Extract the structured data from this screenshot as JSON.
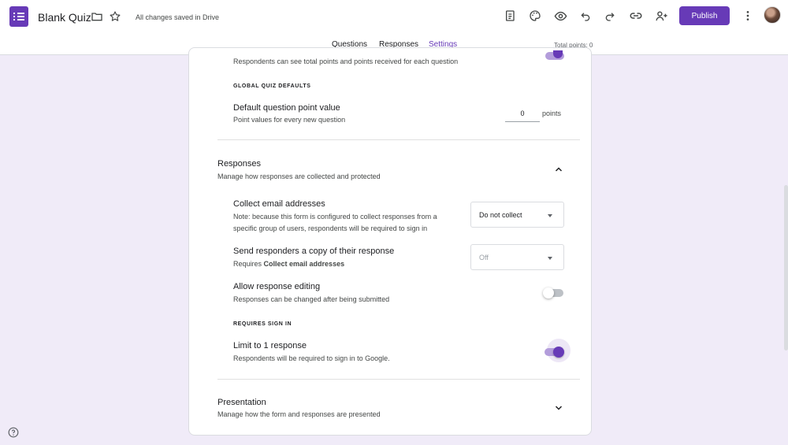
{
  "header": {
    "doc_title": "Blank Quiz",
    "save_status": "All changes saved in Drive",
    "publish_label": "Publish",
    "icons": [
      "forms-app-icon",
      "folder-icon",
      "star-icon",
      "customize-theme-icon",
      "palette-icon",
      "preview-eye-icon",
      "undo-icon",
      "redo-icon",
      "link-icon",
      "add-collaborator-icon",
      "more-vert-icon"
    ],
    "accent_color": "#673ab7"
  },
  "tabs": [
    {
      "label": "Questions",
      "active": false
    },
    {
      "label": "Responses",
      "active": false
    },
    {
      "label": "Settings",
      "active": true
    }
  ],
  "total_points": "Total points: 0",
  "settings": {
    "top_partial_desc": "Respondents can see total points and points received for each question",
    "global_defaults_label": "GLOBAL QUIZ DEFAULTS",
    "default_point": {
      "title": "Default question point value",
      "desc": "Point values for every new question",
      "value": "0",
      "unit": "points"
    },
    "responses": {
      "title": "Responses",
      "desc": "Manage how responses are collected and protected",
      "collect_email": {
        "title": "Collect email addresses",
        "desc_line1": "Note: because this form is configured to collect responses from a",
        "desc_line2": "specific group of users, respondents will be required to sign in",
        "selected": "Do not collect"
      },
      "send_copy": {
        "title": "Send responders a copy of their response",
        "desc_prefix": "Requires ",
        "desc_bold": "Collect email addresses",
        "selected": "Off"
      },
      "allow_editing": {
        "title": "Allow response editing",
        "desc": "Responses can be changed after being submitted",
        "enabled": false
      },
      "requires_sign_in_label": "REQUIRES SIGN IN",
      "limit_one": {
        "title": "Limit to 1 response",
        "desc": "Respondents will be required to sign in to Google.",
        "enabled": true
      }
    },
    "presentation": {
      "title": "Presentation",
      "desc": "Manage how the form and responses are presented"
    }
  }
}
